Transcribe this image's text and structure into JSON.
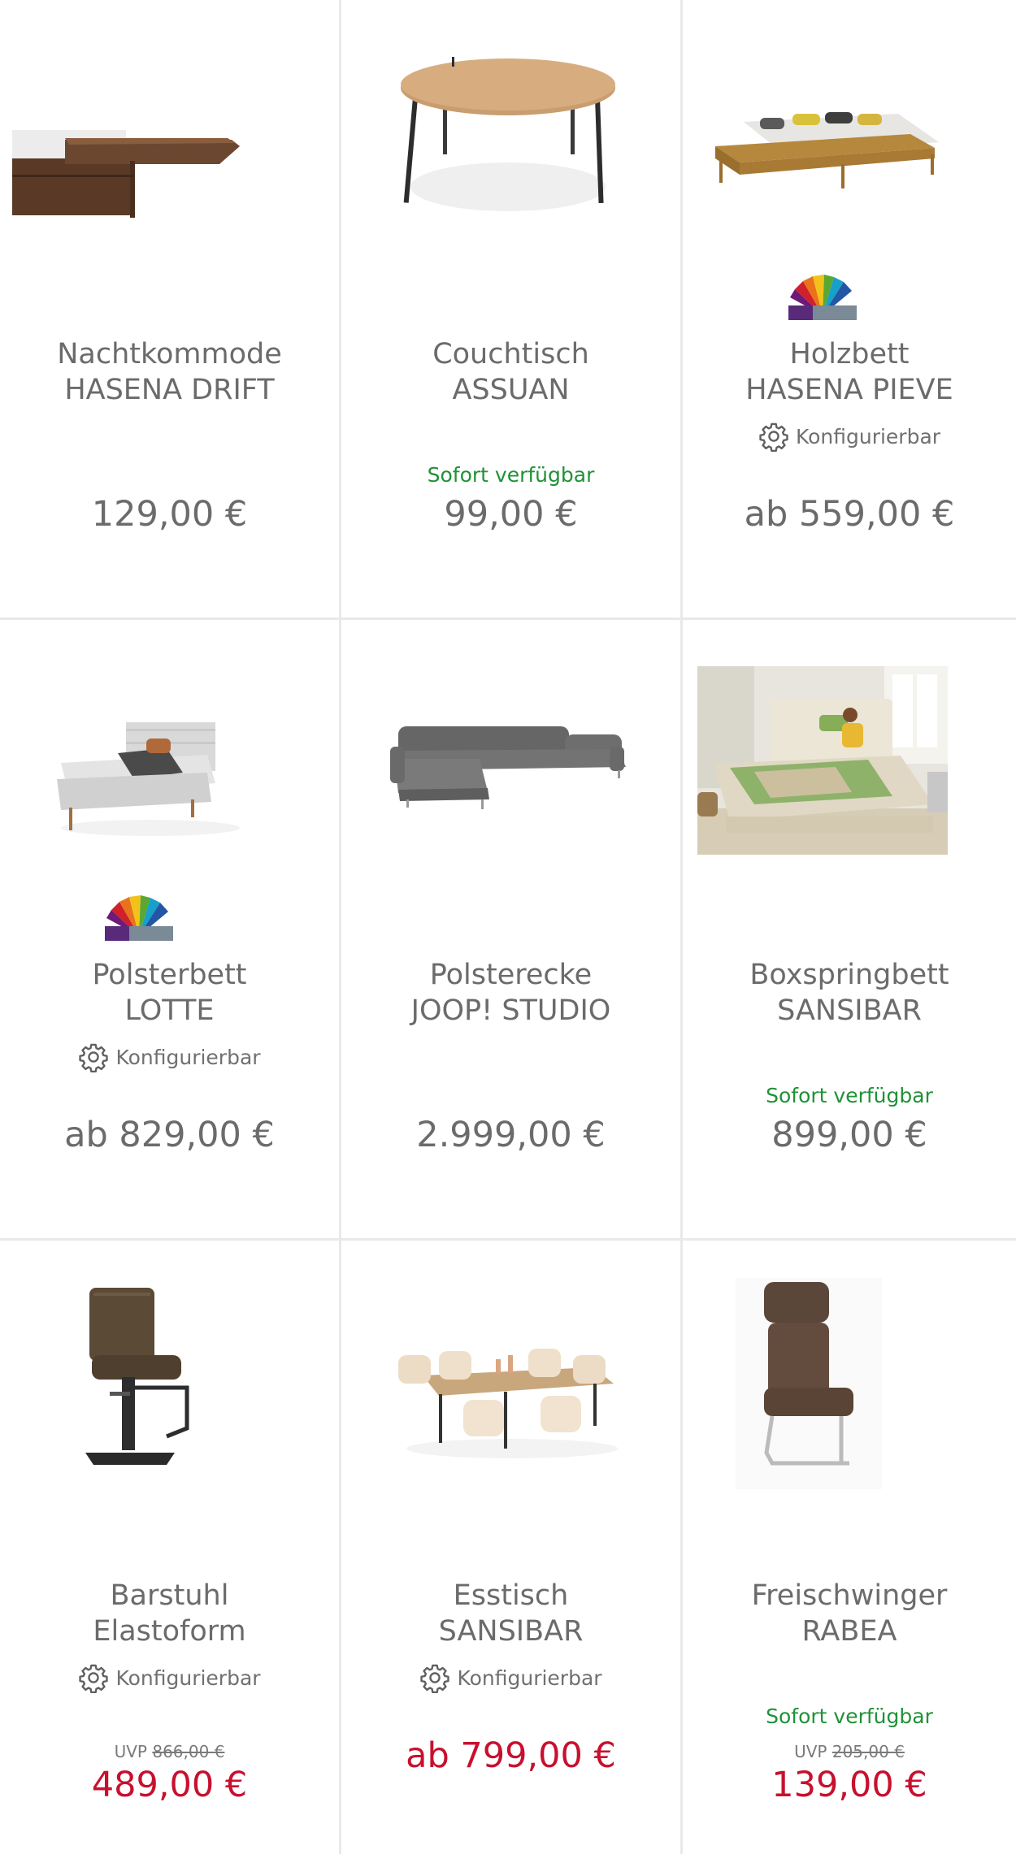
{
  "products": [
    {
      "line1": "Nachtkommode",
      "line2": "HASENA DRIFT",
      "price": "129,00 €",
      "icon": "nightstand-image"
    },
    {
      "line1": "Couchtisch",
      "line2": "ASSUAN",
      "availability": "Sofort verfügbar",
      "price": "99,00 €",
      "icon": "coffee-table-image"
    },
    {
      "line1": "Holzbett",
      "line2": "HASENA PIEVE",
      "configurable": "Konfigurierbar",
      "price": "ab 559,00 €",
      "icon": "wooden-bed-image"
    },
    {
      "line1": "Polsterbett",
      "line2": "LOTTE",
      "configurable": "Konfigurierbar",
      "price": "ab 829,00 €",
      "icon": "upholstered-bed-image"
    },
    {
      "line1": "Polsterecke",
      "line2": "JOOP! STUDIO",
      "price": "2.999,00 €",
      "icon": "corner-sofa-image"
    },
    {
      "line1": "Boxspringbett",
      "line2": "SANSIBAR",
      "availability": "Sofort verfügbar",
      "price": "899,00 €",
      "icon": "boxspring-bed-photo"
    },
    {
      "line1": "Barstuhl",
      "line2": "Elastoform",
      "configurable": "Konfigurierbar",
      "uvp_label": "UVP",
      "uvp_price": "866,00 €",
      "price": "489,00 €",
      "icon": "bar-stool-image"
    },
    {
      "line1": "Esstisch",
      "line2": "SANSIBAR",
      "configurable": "Konfigurierbar",
      "price": "ab 799,00 €",
      "icon": "dining-table-image"
    },
    {
      "line1": "Freischwinger",
      "line2": "RABEA",
      "availability": "Sofort verfügbar",
      "uvp_label": "UVP",
      "uvp_price": "205,00 €",
      "price": "139,00 €",
      "icon": "cantilever-chair-image"
    }
  ],
  "colors": {
    "sale": "#c8102e",
    "available": "#1f9236",
    "text": "#6b6b6b",
    "divider": "#e9e9e9"
  }
}
